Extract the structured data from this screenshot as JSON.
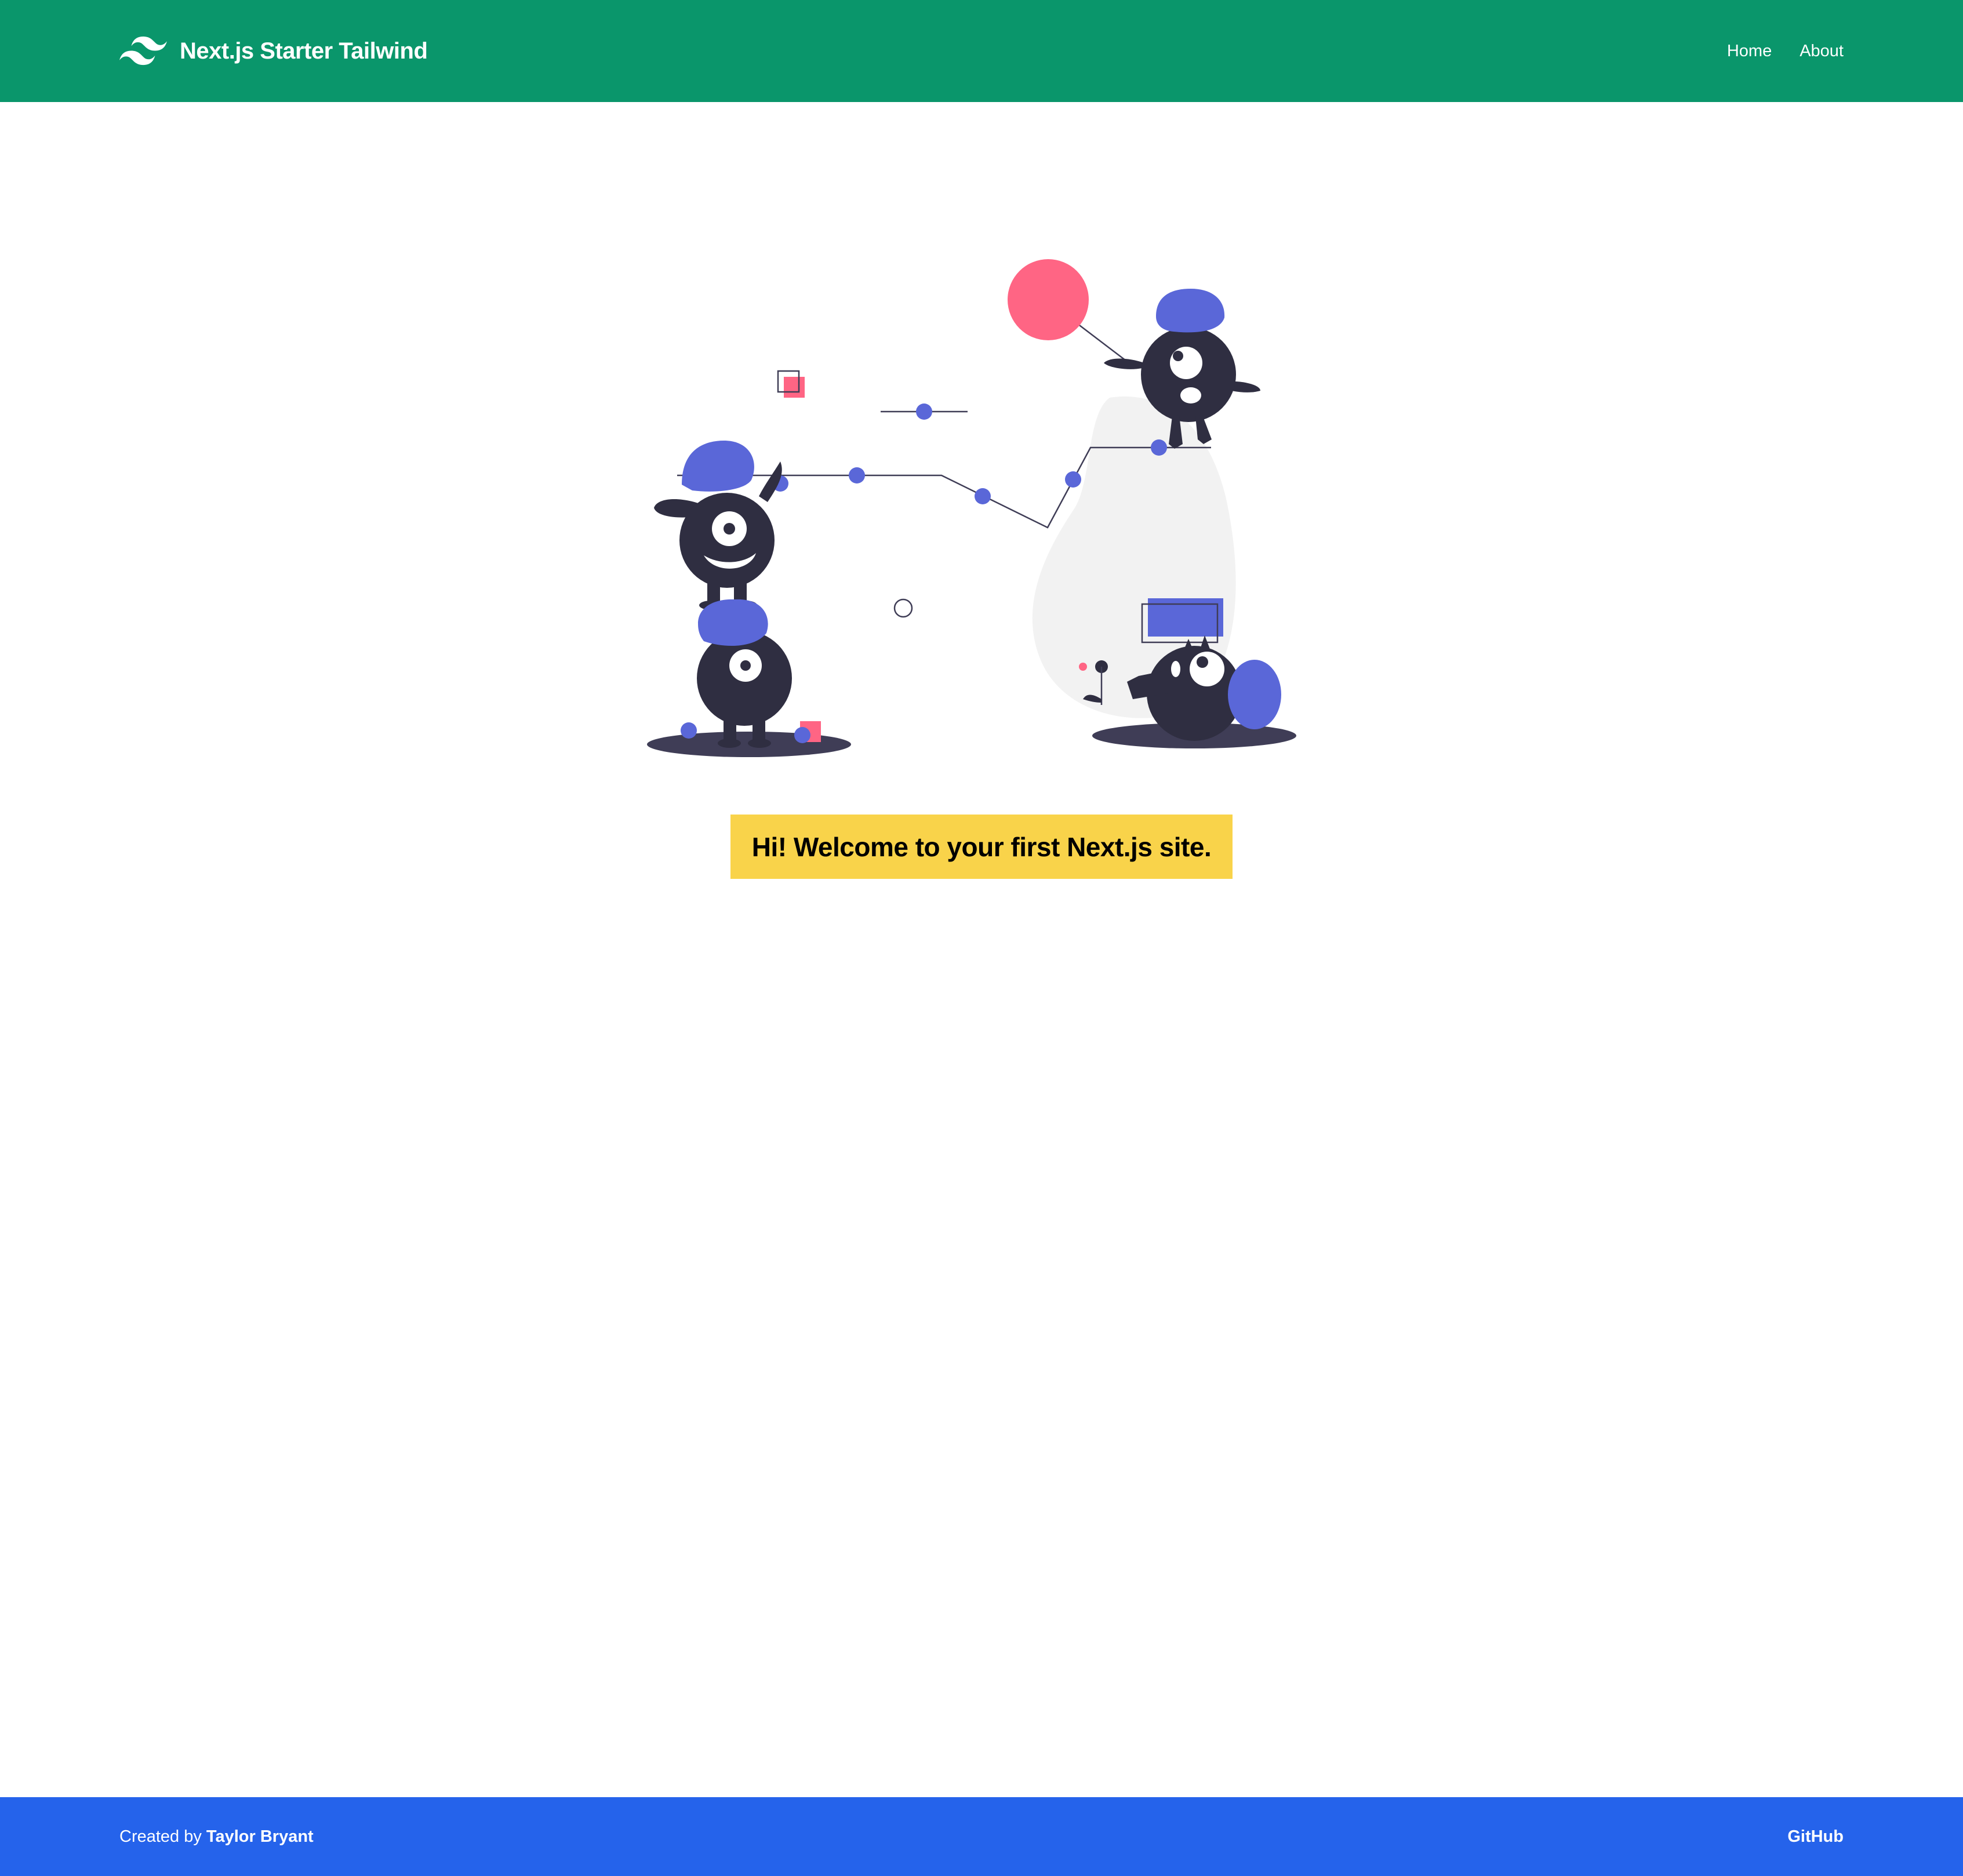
{
  "header": {
    "brand_icon": "tailwind-wave-logo",
    "title": "Next.js Starter Tailwind",
    "nav": [
      {
        "label": "Home"
      },
      {
        "label": "About"
      }
    ]
  },
  "main": {
    "illustration_icon": "monsters-playing-illustration",
    "welcome": "Hi! Welcome to your first Next.js site."
  },
  "footer": {
    "created_prefix": "Created by",
    "author": "Taylor Bryant",
    "github_label": "GitHub"
  },
  "colors": {
    "header_bg": "#0a966b",
    "footer_bg": "#2563eb",
    "welcome_bg": "#f9d34a",
    "monster_body": "#2f2e41",
    "accent_blue": "#5a67d8",
    "accent_pink": "#ff6584",
    "blob_gray": "#f2f2f2"
  }
}
